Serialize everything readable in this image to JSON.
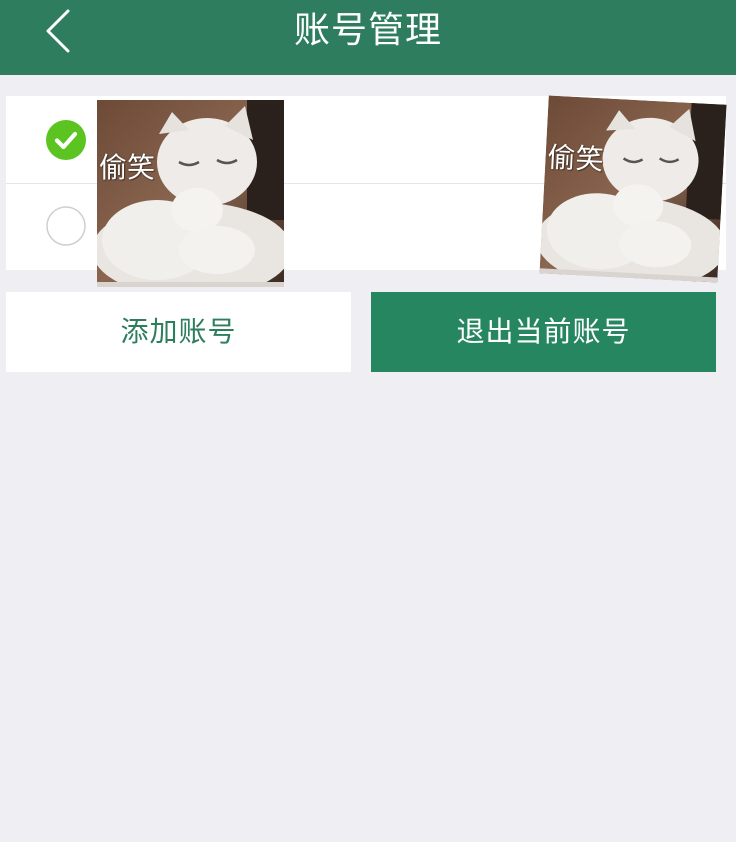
{
  "header": {
    "title": "账号管理",
    "back_icon": "chevron-left-icon"
  },
  "accounts": [
    {
      "selected": true,
      "icon": "check-circle-icon"
    },
    {
      "selected": false,
      "icon": "radio-empty-icon"
    }
  ],
  "stickers": [
    {
      "caption": "偷笑"
    },
    {
      "caption": "偷笑"
    }
  ],
  "actions": {
    "add_account": "添加账号",
    "logout_current": "退出当前账号"
  },
  "colors": {
    "header_bg": "#2e7d5e",
    "page_bg": "#efeef3",
    "check_green": "#5cc421",
    "primary_button": "#268660"
  }
}
